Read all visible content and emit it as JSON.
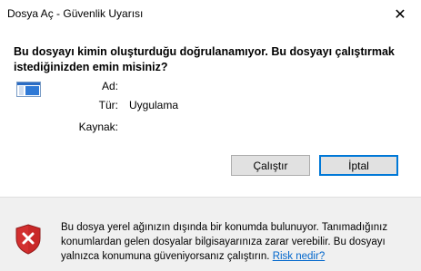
{
  "window": {
    "title": "Dosya Aç - Güvenlik Uyarısı",
    "close_glyph": "✕"
  },
  "headline": "Bu dosyayı kimin oluşturduğu doğrulanamıyor. Bu dosyayı çalıştırmak istediğinizden emin misiniz?",
  "details": {
    "name_label": "Ad:",
    "name_value": "",
    "type_label": "Tür:",
    "type_value": "Uygulama",
    "source_label": "Kaynak:",
    "source_value": ""
  },
  "buttons": {
    "run": "Çalıştır",
    "cancel": "İptal"
  },
  "footer": {
    "warning_text": "Bu dosya yerel ağınızın dışında bir konumda bulunuyor. Tanımadığınız konumlardan gelen dosyalar bilgisayarınıza zarar verebilir. Bu dosyayı yalnızca konumuna güveniyorsanız çalıştırın.",
    "link_text": "Risk nedir?"
  },
  "colors": {
    "accent": "#0078d7",
    "shield_red": "#d32f2f",
    "link": "#0066cc"
  }
}
